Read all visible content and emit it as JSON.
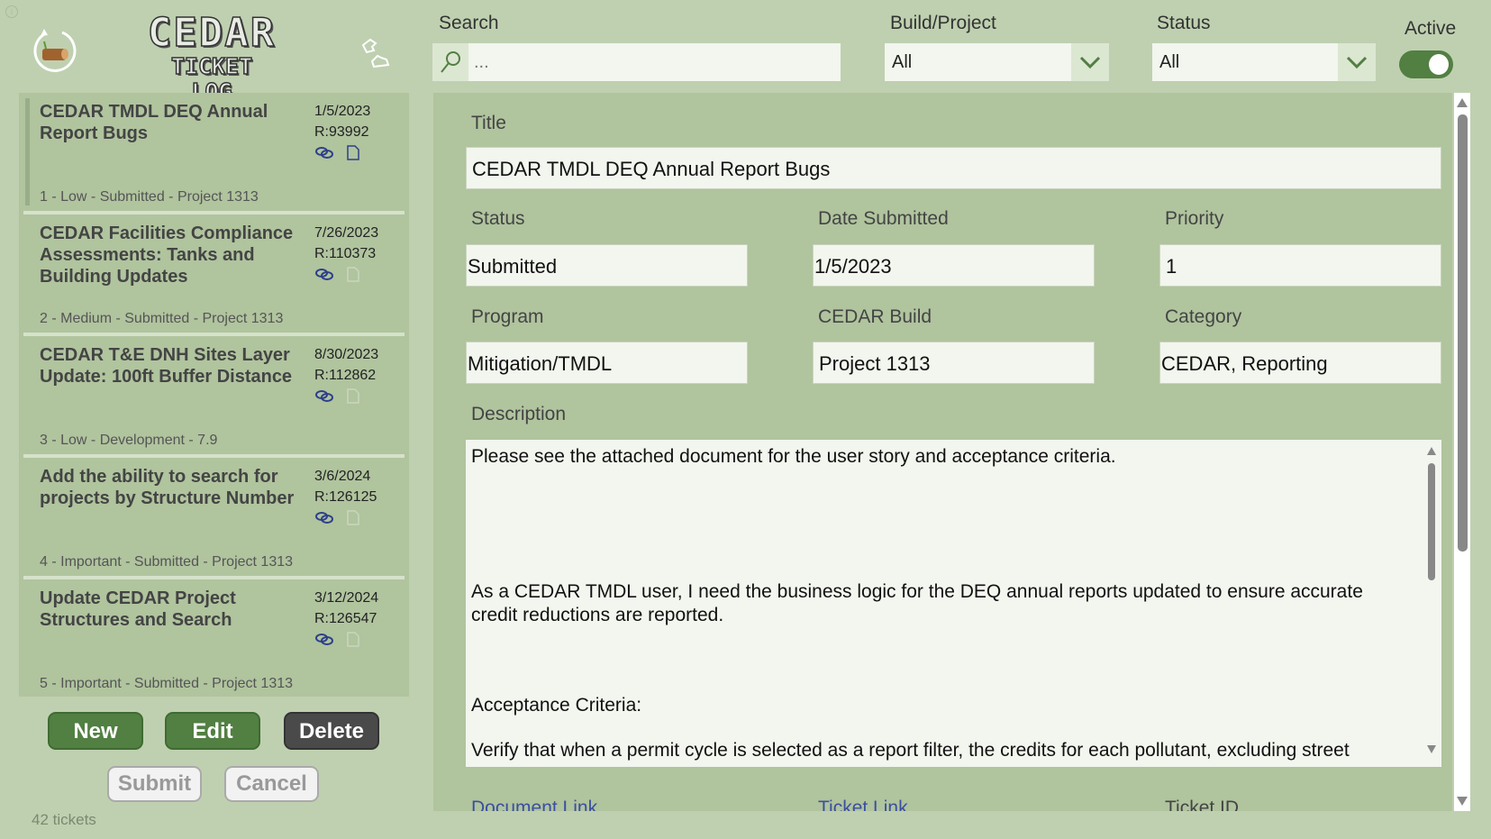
{
  "header": {
    "logo_line1": "CEDAR",
    "logo_line2": "TICKET LOG",
    "search_label": "Search",
    "search_placeholder": "...",
    "build_label": "Build/Project",
    "build_value": "All",
    "status_label": "Status",
    "status_value": "All",
    "active_label": "Active",
    "active_on": true
  },
  "tickets": [
    {
      "title": "CEDAR TMDL DEQ Annual Report Bugs",
      "date": "1/5/2023",
      "ref": "R:93992",
      "meta": "1 - Low - Submitted - Project 1313",
      "has_doc": true
    },
    {
      "title": "CEDAR Facilities Compliance Assessments: Tanks and Building Updates",
      "date": "7/26/2023",
      "ref": "R:110373",
      "meta": "2 - Medium - Submitted - Project 1313",
      "has_doc": false
    },
    {
      "title": "CEDAR T&E DNH Sites Layer Update: 100ft Buffer Distance",
      "date": "8/30/2023",
      "ref": "R:112862",
      "meta": "3 - Low - Development - 7.9",
      "has_doc": false
    },
    {
      "title": "Add the ability to search for projects by Structure Number",
      "date": "3/6/2024",
      "ref": "R:126125",
      "meta": "4 - Important - Submitted - Project 1313",
      "has_doc": false
    },
    {
      "title": "Update CEDAR Project Structures and Search",
      "date": "3/12/2024",
      "ref": "R:126547",
      "meta": "5 - Important - Submitted - Project 1313",
      "has_doc": false
    }
  ],
  "buttons": {
    "new": "New",
    "edit": "Edit",
    "delete": "Delete",
    "submit": "Submit",
    "cancel": "Cancel"
  },
  "count": "42 tickets",
  "form": {
    "title_label": "Title",
    "title_value": "CEDAR TMDL DEQ Annual Report Bugs",
    "status_label": "Status",
    "status_value": "Submitted",
    "date_label": "Date Submitted",
    "date_value": "1/5/2023",
    "priority_label": "Priority",
    "priority_value": "1",
    "program_label": "Program",
    "program_value": "Mitigation/TMDL",
    "build_label": "CEDAR Build",
    "build_value": "Project 1313",
    "category_label": "Category",
    "category_value": "CEDAR, Reporting",
    "description_label": "Description",
    "description": [
      "Please see the attached document for the user story and acceptance criteria.",
      "As a CEDAR TMDL user, I need the business logic for the DEQ annual reports updated to ensure accurate credit reductions are reported.",
      "Acceptance Criteria:",
      "Verify that when a permit cycle is selected as a report filter, the credits for each pollutant, excluding street"
    ],
    "document_link_label": "Document Link",
    "ticket_link_label": "Ticket Link",
    "ticket_id_label": "Ticket ID"
  },
  "colors": {
    "bg": "#bfd0b0",
    "panel": "#b0c49e",
    "accent": "#527f42",
    "dark": "#4a4a4a",
    "link": "#3b4fa0"
  }
}
